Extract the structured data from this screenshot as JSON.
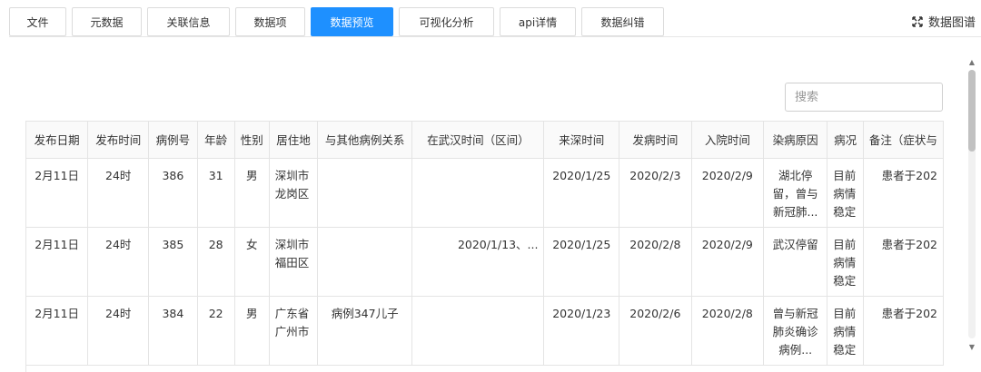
{
  "tabs": [
    {
      "label": "文件"
    },
    {
      "label": "元数据"
    },
    {
      "label": "关联信息"
    },
    {
      "label": "数据项"
    },
    {
      "label": "数据预览"
    },
    {
      "label": "可视化分析"
    },
    {
      "label": "api详情"
    },
    {
      "label": "数据纠错"
    }
  ],
  "active_tab": "数据预览",
  "graph_link": {
    "label": "数据图谱",
    "icon": "expand-icon"
  },
  "search": {
    "placeholder": "搜索",
    "value": ""
  },
  "table": {
    "columns": [
      "发布日期",
      "发布时间",
      "病例号",
      "年龄",
      "性别",
      "居住地",
      "与其他病例关系",
      "在武汉时间（区间）",
      "来深时间",
      "发病时间",
      "入院时间",
      "染病原因",
      "病况",
      "备注（症状与"
    ],
    "rows": [
      [
        "2月11日",
        "24时",
        "386",
        "31",
        "男",
        "深圳市龙岗区",
        "",
        "",
        "2020/1/25",
        "2020/2/3",
        "2020/2/9",
        "湖北停留，曾与新冠肺...",
        "目前病情稳定",
        "患者于202"
      ],
      [
        "2月11日",
        "24时",
        "385",
        "28",
        "女",
        "深圳市福田区",
        "",
        "2020/1/13、...",
        "2020/1/25",
        "2020/2/8",
        "2020/2/9",
        "武汉停留",
        "目前病情稳定",
        "患者于202"
      ],
      [
        "2月11日",
        "24时",
        "384",
        "22",
        "男",
        "广东省广州市",
        "病例347儿子",
        "",
        "2020/1/23",
        "2020/2/6",
        "2020/2/8",
        "曾与新冠肺炎确诊病例...",
        "目前病情稳定",
        "患者于202"
      ]
    ]
  },
  "colors": {
    "accent": "#1e90ff",
    "border": "#e4e4e4"
  }
}
